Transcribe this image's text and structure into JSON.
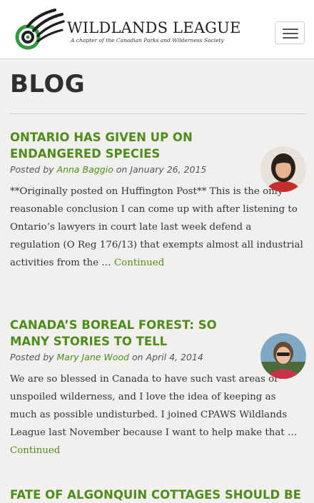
{
  "header": {
    "logo_title": "WILDLANDS LEAGUE",
    "logo_subtitle": "A chapter of the Canadian Parks and Wilderness Society",
    "menu_icon": "hamburger-icon"
  },
  "page_title": "BLOG",
  "posts": [
    {
      "title": "ONTARIO HAS GIVEN UP ON ENDANGERED SPECIES",
      "posted_by": "Posted by",
      "author": "Anna Baggio",
      "on_label": "on",
      "date": "January 26, 2015",
      "excerpt": "**Originally posted on Huffington Post** This is the only reasonable conclusion I can come up with after listening to Ontario’s lawyers in court late last week defend a regulation (O Reg 176/13) that exempts almost all industrial activities from the … ",
      "continue_label": "Continued"
    },
    {
      "title": "CANADA’S BOREAL FOREST: SO MANY STORIES TO TELL",
      "posted_by": "Posted by",
      "author": "Mary Jane Wood",
      "on_label": "on",
      "date": "April 4, 2014",
      "excerpt": "We are so blessed in Canada to have such vast areas of unspoiled wilderness, and I love the idea of keeping as much as possible undisturbed. I joined CPAWS Wildlands League last November because I want to help make that … ",
      "continue_label": "Continued"
    },
    {
      "title": "FATE OF ALGONQUIN COTTAGES SHOULD BE"
    }
  ],
  "colors": {
    "accent_green": "#4f8c19",
    "background": "#f1f0ee"
  }
}
